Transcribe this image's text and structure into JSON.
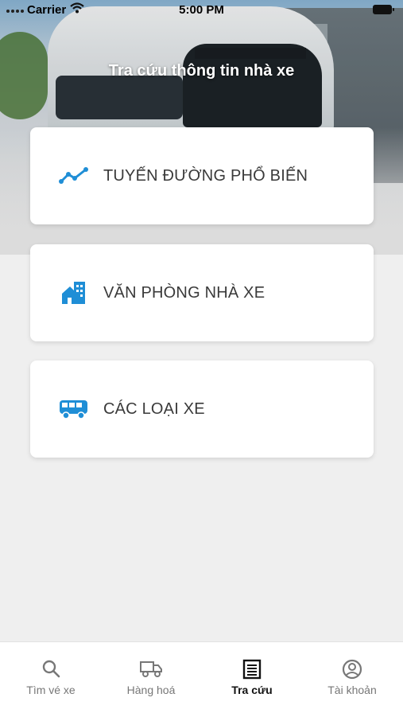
{
  "status_bar": {
    "carrier": "Carrier",
    "time": "5:00 PM"
  },
  "header": {
    "title": "Tra cứu thông tin nhà xe"
  },
  "menu": {
    "items": [
      {
        "label": "TUYẾN ĐƯỜNG PHỔ BIẾN",
        "icon": "route-trend-icon"
      },
      {
        "label": "VĂN PHÒNG NHÀ XE",
        "icon": "office-building-icon"
      },
      {
        "label": "CÁC LOẠI XE",
        "icon": "bus-icon"
      }
    ]
  },
  "tabbar": {
    "tabs": [
      {
        "label": "Tìm vé xe",
        "icon": "search-icon"
      },
      {
        "label": "Hàng hoá",
        "icon": "truck-icon"
      },
      {
        "label": "Tra cứu",
        "icon": "document-list-icon",
        "active": true
      },
      {
        "label": "Tài khoản",
        "icon": "user-circle-icon"
      }
    ]
  },
  "colors": {
    "accent": "#1f8ed6",
    "card_bg": "#ffffff",
    "page_bg": "#efefef",
    "tab_active": "#111111",
    "tab_inactive": "#777777"
  }
}
